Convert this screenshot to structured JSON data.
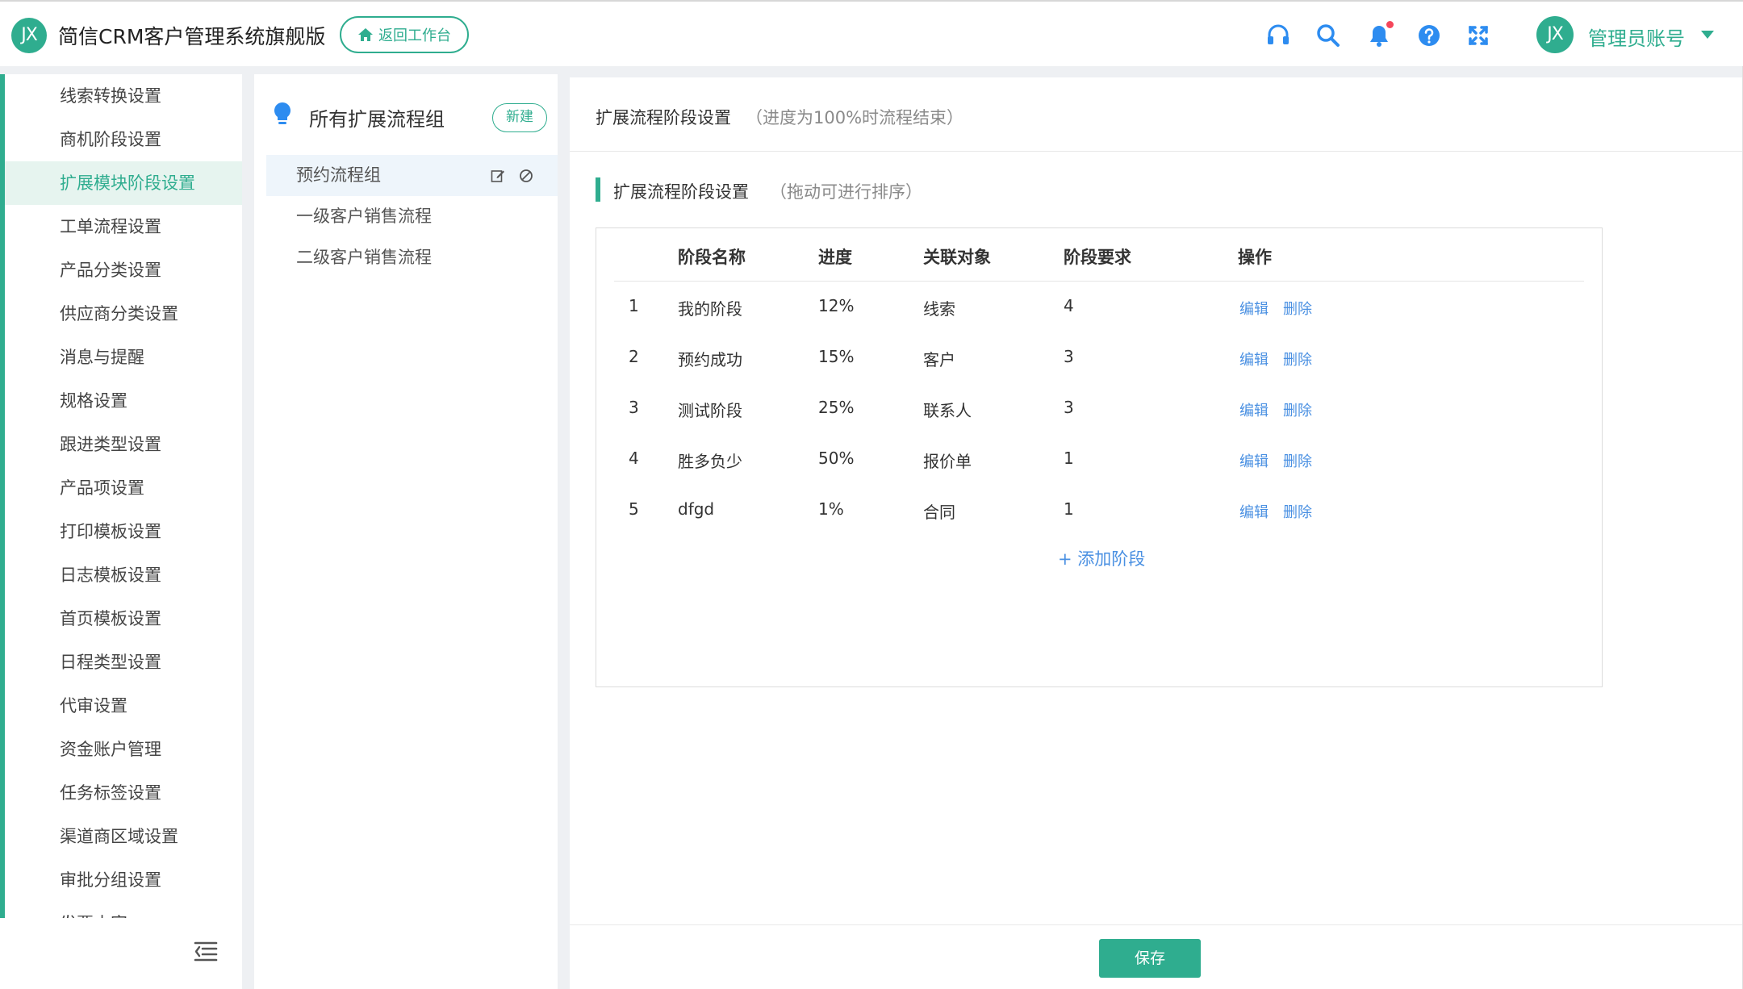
{
  "app": {
    "logo_text": "JX",
    "title": "简信CRM客户管理系统旗舰版",
    "back_button": "返回工作台"
  },
  "header_icons": [
    "headset-icon",
    "search-icon",
    "bell-icon",
    "help-icon",
    "fullscreen-icon"
  ],
  "user": {
    "avatar_text": "JX",
    "name": "管理员账号"
  },
  "sidebar": {
    "items": [
      {
        "label": "线索转换设置"
      },
      {
        "label": "商机阶段设置"
      },
      {
        "label": "扩展模块阶段设置"
      },
      {
        "label": "工单流程设置"
      },
      {
        "label": "产品分类设置"
      },
      {
        "label": "供应商分类设置"
      },
      {
        "label": "消息与提醒"
      },
      {
        "label": "规格设置"
      },
      {
        "label": "跟进类型设置"
      },
      {
        "label": "产品项设置"
      },
      {
        "label": "打印模板设置"
      },
      {
        "label": "日志模板设置"
      },
      {
        "label": "首页模板设置"
      },
      {
        "label": "日程类型设置"
      },
      {
        "label": "代审设置"
      },
      {
        "label": "资金账户管理"
      },
      {
        "label": "任务标签设置"
      },
      {
        "label": "渠道商区域设置"
      },
      {
        "label": "审批分组设置"
      },
      {
        "label": "发票内容"
      }
    ],
    "active_index": 2
  },
  "groups": {
    "title": "所有扩展流程组",
    "new_button": "新建",
    "items": [
      {
        "label": "预约流程组"
      },
      {
        "label": "一级客户销售流程"
      },
      {
        "label": "二级客户销售流程"
      }
    ]
  },
  "main": {
    "title": "扩展流程阶段设置",
    "subtitle": "（进度为100%时流程结束）",
    "section_title": "扩展流程阶段设置",
    "section_hint": "（拖动可进行排序）",
    "columns": [
      "阶段名称",
      "进度",
      "关联对象",
      "阶段要求",
      "操作"
    ],
    "rows": [
      {
        "index": "1",
        "name": "我的阶段",
        "progress": "12%",
        "object": "线索",
        "requirement": "4",
        "edit": "编辑",
        "delete": "删除"
      },
      {
        "index": "2",
        "name": "预约成功",
        "progress": "15%",
        "object": "客户",
        "requirement": "3",
        "edit": "编辑",
        "delete": "删除"
      },
      {
        "index": "3",
        "name": "测试阶段",
        "progress": "25%",
        "object": "联系人",
        "requirement": "3",
        "edit": "编辑",
        "delete": "删除"
      },
      {
        "index": "4",
        "name": "胜多负少",
        "progress": "50%",
        "object": "报价单",
        "requirement": "1",
        "edit": "编辑",
        "delete": "删除"
      },
      {
        "index": "5",
        "name": "dfgd",
        "progress": "1%",
        "object": "合同",
        "requirement": "1",
        "edit": "编辑",
        "delete": "删除"
      }
    ],
    "add_stage": "+ 添加阶段",
    "save_button": "保存"
  },
  "colors": {
    "accent": "#2fad8f",
    "link": "#4a90e2",
    "notification_dot": "#f5465a",
    "icon_blue": "#2d8cf0"
  }
}
